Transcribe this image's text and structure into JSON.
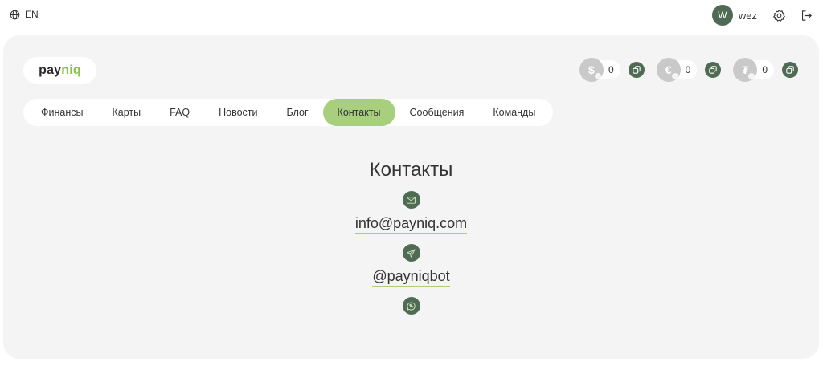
{
  "topbar": {
    "lang_icon": "globe-icon",
    "lang_label": "EN",
    "avatar_initial": "W",
    "username": "wez",
    "settings_icon": "gear-icon",
    "logout_icon": "logout-icon"
  },
  "brand": {
    "logo_part1": "pay",
    "logo_part2": "niq",
    "accent": "#a7cf7d",
    "primary_dark": "#4f6b54"
  },
  "wallets": [
    {
      "symbol": "$",
      "amount": "0",
      "icon": "dollar-coin-icon"
    },
    {
      "symbol": "€",
      "amount": "0",
      "icon": "euro-coin-icon"
    },
    {
      "symbol": "₮",
      "amount": "0",
      "icon": "tether-coin-icon"
    }
  ],
  "nav": {
    "items": [
      {
        "label": "Финансы"
      },
      {
        "label": "Карты"
      },
      {
        "label": "FAQ"
      },
      {
        "label": "Новости"
      },
      {
        "label": "Блог"
      },
      {
        "label": "Контакты",
        "active": true
      },
      {
        "label": "Сообщения"
      },
      {
        "label": "Команды"
      }
    ]
  },
  "contacts": {
    "title": "Контакты",
    "email": "info@payniq.com",
    "telegram": "@payniqbot",
    "email_icon": "mail-icon",
    "telegram_icon": "telegram-icon",
    "whatsapp_icon": "whatsapp-icon"
  }
}
